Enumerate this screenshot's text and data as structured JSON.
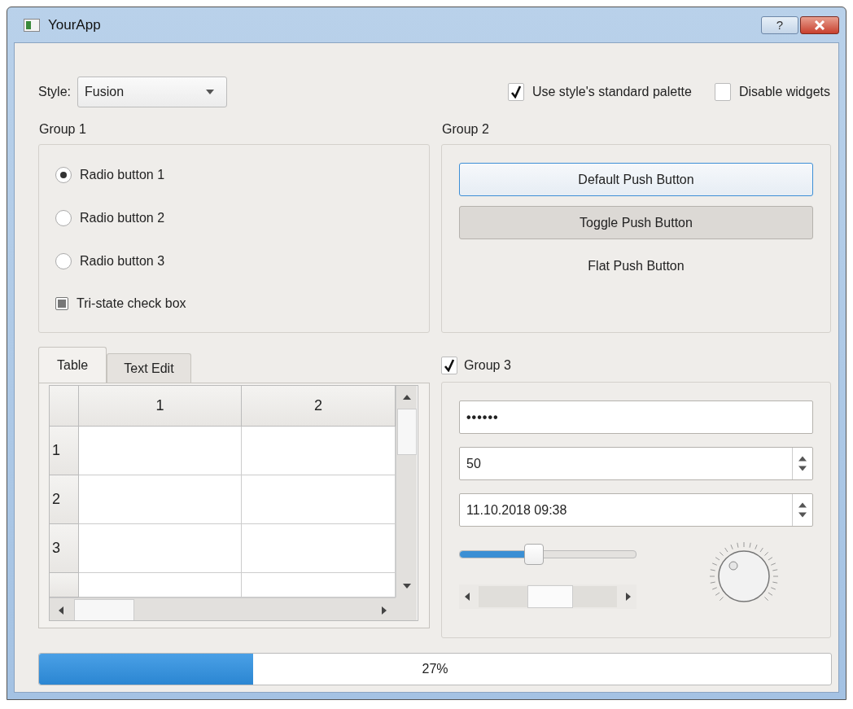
{
  "window": {
    "title": "YourApp",
    "help_label": "?"
  },
  "style_picker": {
    "label": "Style:",
    "value": "Fusion"
  },
  "options": [
    {
      "label": "Use style's standard palette",
      "checked": true
    },
    {
      "label": "Disable widgets",
      "checked": false
    }
  ],
  "group1": {
    "title": "Group 1",
    "radios": [
      {
        "label": "Radio button 1",
        "selected": true
      },
      {
        "label": "Radio button 2",
        "selected": false
      },
      {
        "label": "Radio button 3",
        "selected": false
      }
    ],
    "tristate": {
      "label": "Tri-state check box",
      "partially_checked": true
    }
  },
  "group2": {
    "title": "Group 2",
    "buttons": [
      {
        "label": "Default Push Button",
        "kind": "default"
      },
      {
        "label": "Toggle Push Button",
        "kind": "toggle",
        "on": true
      },
      {
        "label": "Flat Push Button",
        "kind": "flat"
      }
    ]
  },
  "tabs": [
    {
      "label": "Table",
      "selected": true
    },
    {
      "label": "Text Edit",
      "selected": false
    }
  ],
  "table": {
    "columns": [
      "1",
      "2"
    ],
    "rows": [
      "1",
      "2",
      "3"
    ]
  },
  "group3": {
    "title": "Group 3",
    "checked": true,
    "password": "••••••",
    "spin_value": "50",
    "datetime": "11.10.2018 09:38",
    "slider": {
      "level": 0.42
    }
  },
  "progress": {
    "level": 0.27,
    "reading": "27%"
  }
}
